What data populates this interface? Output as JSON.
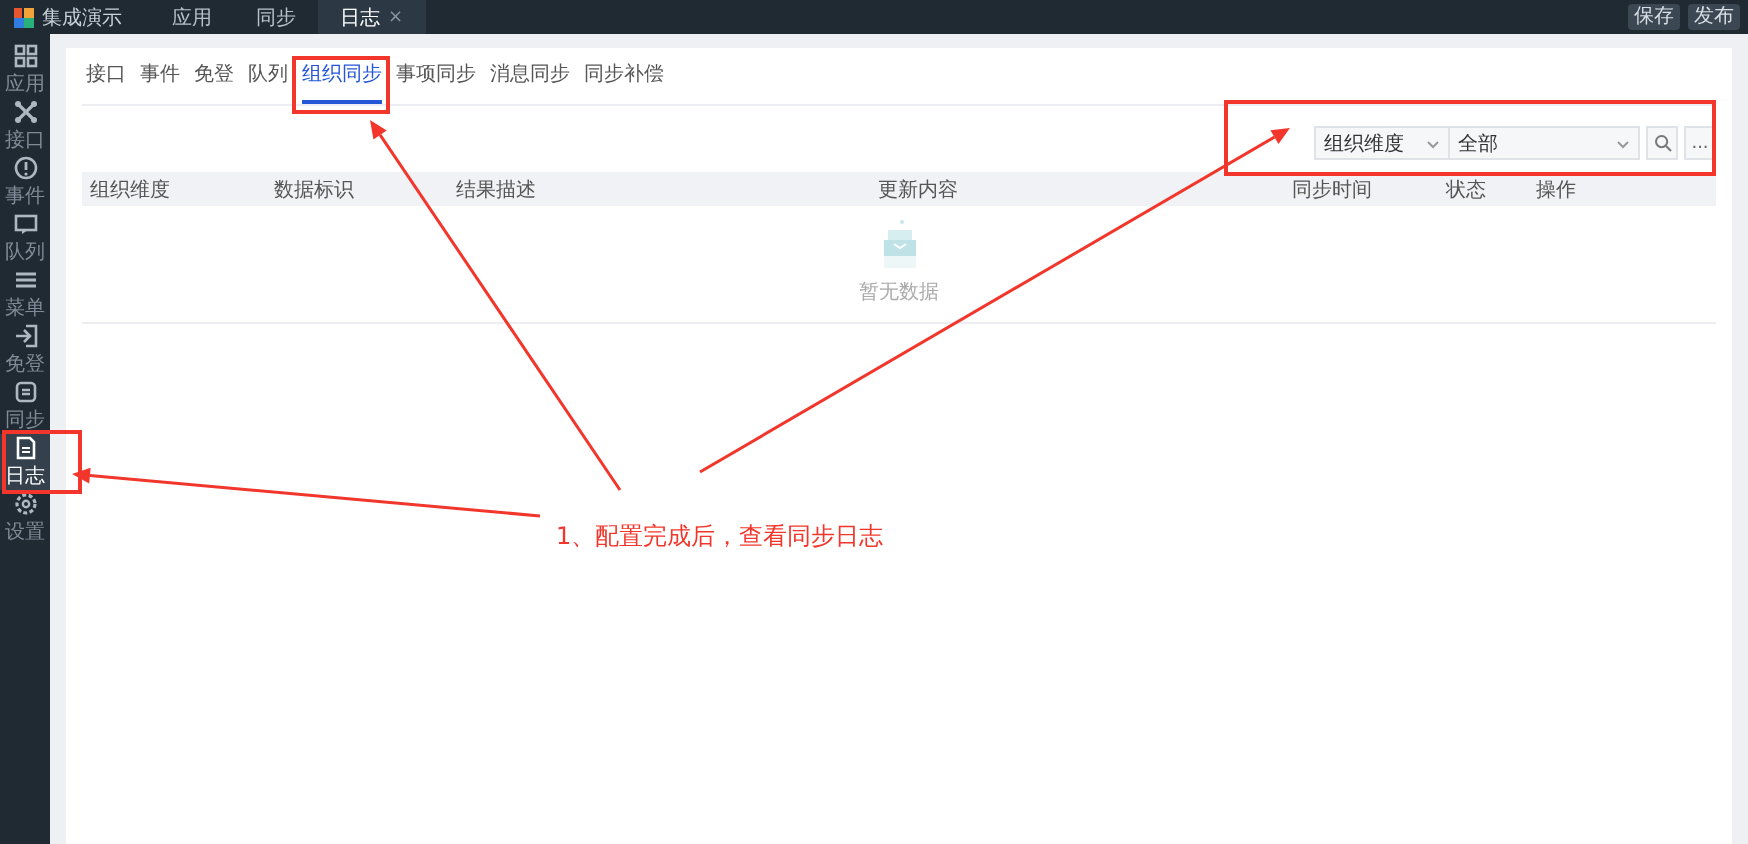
{
  "app": {
    "title": "集成演示",
    "nav_tabs": [
      {
        "label": "应用",
        "selected": false
      },
      {
        "label": "同步",
        "selected": false
      },
      {
        "label": "日志",
        "selected": true,
        "close": "×"
      }
    ],
    "actions": [
      "保存",
      "发布"
    ]
  },
  "sidebar": {
    "items": [
      {
        "label": "应用",
        "selected": false
      },
      {
        "label": "接口",
        "selected": false
      },
      {
        "label": "事件",
        "selected": false
      },
      {
        "label": "队列",
        "selected": false
      },
      {
        "label": "菜单",
        "selected": false
      },
      {
        "label": "免登",
        "selected": false
      },
      {
        "label": "同步",
        "selected": false
      },
      {
        "label": "日志",
        "selected": true
      },
      {
        "label": "设置",
        "selected": false
      }
    ]
  },
  "tabs": [
    {
      "label": "接口",
      "selected": false
    },
    {
      "label": "事件",
      "selected": false
    },
    {
      "label": "免登",
      "selected": false
    },
    {
      "label": "队列",
      "selected": false
    },
    {
      "label": "组织同步",
      "selected": true
    },
    {
      "label": "事项同步",
      "selected": false
    },
    {
      "label": "消息同步",
      "selected": false
    },
    {
      "label": "同步补偿",
      "selected": false
    }
  ],
  "filters": {
    "dimension": "组织维度",
    "scope": "全部",
    "more": "..."
  },
  "table": {
    "columns": [
      "组织维度",
      "数据标识",
      "结果描述",
      "更新内容",
      "同步时间",
      "状态",
      "操作"
    ],
    "empty": "暂无数据"
  },
  "annotation": {
    "text": "1、配置完成后，查看同步日志"
  }
}
